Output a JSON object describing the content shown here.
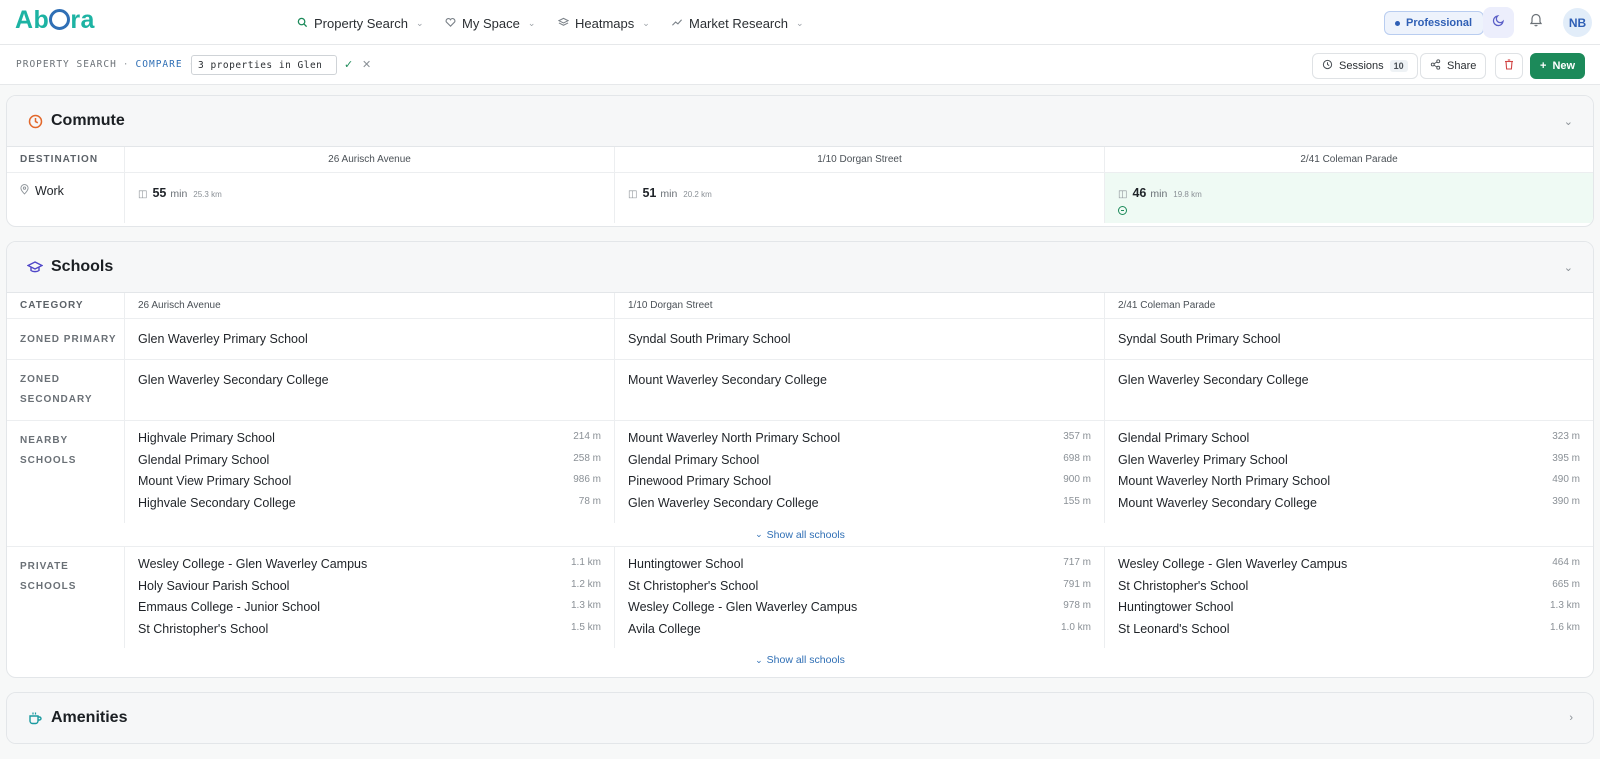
{
  "app": {
    "logo": "Abora"
  },
  "nav": {
    "items": [
      {
        "label": "Property Search",
        "icon": "search-icon"
      },
      {
        "label": "My Space",
        "icon": "heart-icon"
      },
      {
        "label": "Heatmaps",
        "icon": "layers-icon"
      },
      {
        "label": "Market Research",
        "icon": "trend-icon"
      }
    ],
    "plan_badge": "Professional",
    "avatar": "NB"
  },
  "toolbar": {
    "crumb_1": "PROPERTY SEARCH",
    "crumb_2": "COMPARE",
    "session_name": "3 properties in Glen",
    "sessions_label": "Sessions",
    "sessions_count": "10",
    "share_label": "Share",
    "new_label": "New"
  },
  "properties": [
    "26 Aurisch Avenue",
    "1/10 Dorgan Street",
    "2/41 Coleman Parade"
  ],
  "commute": {
    "title": "Commute",
    "header": "DESTINATION",
    "destination": "Work",
    "values": [
      {
        "mins": "55",
        "unit": "min",
        "km": "25.3 km"
      },
      {
        "mins": "51",
        "unit": "min",
        "km": "20.2 km"
      },
      {
        "mins": "46",
        "unit": "min",
        "km": "19.8 km"
      }
    ]
  },
  "schools": {
    "title": "Schools",
    "header": "CATEGORY",
    "zoned_primary_label": "ZONED PRIMARY",
    "zoned_primary": [
      "Glen Waverley Primary School",
      "Syndal South Primary School",
      "Syndal South Primary School"
    ],
    "zoned_secondary_label_1": "ZONED",
    "zoned_secondary_label_2": "SECONDARY",
    "zoned_secondary": [
      "Glen Waverley Secondary College",
      "Mount Waverley Secondary College",
      "Glen Waverley Secondary College"
    ],
    "nearby_label_1": "NEARBY",
    "nearby_label_2": "SCHOOLS",
    "nearby": [
      [
        {
          "name": "Highvale Primary School",
          "dist": "214 m"
        },
        {
          "name": "Glendal Primary School",
          "dist": "258 m"
        },
        {
          "name": "Mount View Primary School",
          "dist": "986 m"
        },
        {
          "name": "Highvale Secondary College",
          "dist": "78 m"
        }
      ],
      [
        {
          "name": "Mount Waverley North Primary School",
          "dist": "357 m"
        },
        {
          "name": "Glendal Primary School",
          "dist": "698 m"
        },
        {
          "name": "Pinewood Primary School",
          "dist": "900 m"
        },
        {
          "name": "Glen Waverley Secondary College",
          "dist": "155 m"
        }
      ],
      [
        {
          "name": "Glendal Primary School",
          "dist": "323 m"
        },
        {
          "name": "Glen Waverley Primary School",
          "dist": "395 m"
        },
        {
          "name": "Mount Waverley North Primary School",
          "dist": "490 m"
        },
        {
          "name": "Mount Waverley Secondary College",
          "dist": "390 m"
        }
      ]
    ],
    "private_label_1": "PRIVATE",
    "private_label_2": "SCHOOLS",
    "private": [
      [
        {
          "name": "Wesley College - Glen Waverley Campus",
          "dist": "1.1 km"
        },
        {
          "name": "Holy Saviour Parish School",
          "dist": "1.2 km"
        },
        {
          "name": "Emmaus College - Junior School",
          "dist": "1.3 km"
        },
        {
          "name": "St Christopher's School",
          "dist": "1.5 km"
        }
      ],
      [
        {
          "name": "Huntingtower School",
          "dist": "717 m"
        },
        {
          "name": "St Christopher's School",
          "dist": "791 m"
        },
        {
          "name": "Wesley College - Glen Waverley Campus",
          "dist": "978 m"
        },
        {
          "name": "Avila College",
          "dist": "1.0 km"
        }
      ],
      [
        {
          "name": "Wesley College - Glen Waverley Campus",
          "dist": "464 m"
        },
        {
          "name": "St Christopher's School",
          "dist": "665 m"
        },
        {
          "name": "Huntingtower School",
          "dist": "1.3 km"
        },
        {
          "name": "St Leonard's School",
          "dist": "1.6 km"
        }
      ]
    ],
    "show_all": "Show all schools"
  },
  "amenities": {
    "title": "Amenities"
  },
  "colors": {
    "brand": "#1db3a3",
    "accent": "#2f6fb5",
    "primary_button": "#1c8a5a",
    "best_highlight": "#effaf4"
  }
}
